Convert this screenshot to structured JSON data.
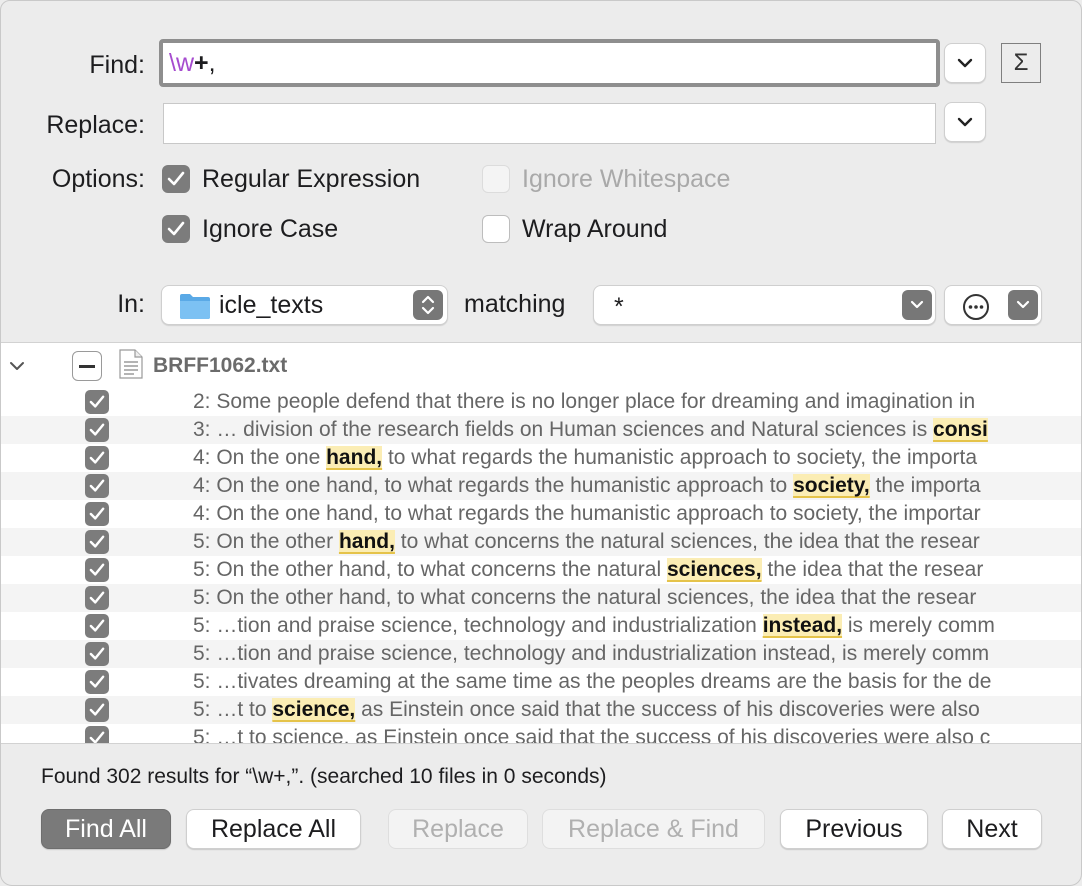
{
  "find": {
    "label": "Find:",
    "value_escape": "\\w",
    "value_plus": "+",
    "value_rest": ","
  },
  "replace": {
    "label": "Replace:",
    "value": ""
  },
  "options": {
    "label": "Options:",
    "regex": {
      "label": "Regular Expression",
      "checked": true
    },
    "ignore_whitespace": {
      "label": "Ignore Whitespace",
      "checked": false,
      "disabled": true
    },
    "ignore_case": {
      "label": "Ignore Case",
      "checked": true
    },
    "wrap_around": {
      "label": "Wrap Around",
      "checked": false
    }
  },
  "scope": {
    "in_label": "In:",
    "folder": "icle_texts",
    "matching_label": "matching",
    "pattern": "*"
  },
  "file": {
    "name": "BRFF1062.txt"
  },
  "results": [
    {
      "pre": "2: Some people defend that there is no longer place for dreaming and imagination in",
      "hit": "",
      "post": ""
    },
    {
      "pre": "3: … division of the research fields on Human sciences and Natural sciences is ",
      "hit": "consi",
      "post": ""
    },
    {
      "pre": "4: On the one ",
      "hit": "hand,",
      "post": " to what regards the humanistic approach to society, the importa"
    },
    {
      "pre": "4: On the one hand, to what regards the humanistic approach to ",
      "hit": "society,",
      "post": " the importa"
    },
    {
      "pre": "4: On the one hand, to what regards the humanistic approach to society, the importar",
      "hit": "",
      "post": ""
    },
    {
      "pre": "5: On the other ",
      "hit": "hand,",
      "post": " to what concerns the natural sciences, the idea that the resear"
    },
    {
      "pre": "5: On the other hand, to what concerns the natural ",
      "hit": "sciences,",
      "post": " the idea that the resear"
    },
    {
      "pre": "5: On the other hand, to what concerns the natural sciences, the idea that the resear",
      "hit": "",
      "post": ""
    },
    {
      "pre": "5: …tion and praise science, technology and industrialization ",
      "hit": "instead,",
      "post": " is merely comm"
    },
    {
      "pre": "5: …tion and praise science, technology and industrialization instead, is merely comm",
      "hit": "",
      "post": ""
    },
    {
      "pre": "5: …tivates dreaming at the same time as the peoples dreams are the basis for the de",
      "hit": "",
      "post": ""
    },
    {
      "pre": "5: …t to ",
      "hit": "science,",
      "post": " as Einstein once said that the success of his discoveries were also"
    },
    {
      "pre": "5: …t to science, as Einstein once said that the success of his discoveries were also c",
      "hit": "",
      "post": ""
    }
  ],
  "status_text": "Found 302 results for “\\w+,”. (searched 10 files in 0 seconds)",
  "buttons": {
    "find_all": "Find All",
    "replace_all": "Replace All",
    "replace": "Replace",
    "replace_find": "Replace & Find",
    "previous": "Previous",
    "next": "Next"
  },
  "colors": {
    "regex_escape": "#a64ccf",
    "highlight": "#fbedb4",
    "checkbox_on": "#7c7c7c",
    "primary_button": "#7a7a7a"
  }
}
